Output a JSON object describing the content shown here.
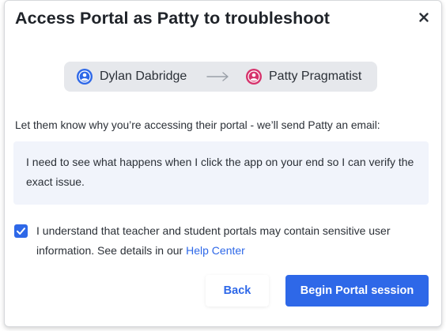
{
  "dialog": {
    "title": "Access Portal as Patty to troubleshoot",
    "close_icon": "close-icon"
  },
  "impersonation": {
    "from_user": {
      "name": "Dylan Dabridge",
      "icon": "user-circle-icon",
      "color": "#2e68e8"
    },
    "arrow_icon": "arrow-right-icon",
    "to_user": {
      "name": "Patty Pragmatist",
      "icon": "user-circle-icon",
      "color": "#d6336c"
    }
  },
  "reason": {
    "prompt": "Let them know why you’re accessing their portal - we’ll send Patty an email:",
    "message": "I need to see what happens when I click the app on your end so I can verify the exact issue."
  },
  "consent": {
    "checked": true,
    "text": "I understand that teacher and student portals may contain sensitive user information. See details in our ",
    "link_text": "Help Center"
  },
  "actions": {
    "back_label": "Back",
    "begin_label": "Begin Portal session"
  },
  "colors": {
    "accent": "#2e68e8",
    "pill_bg": "#e6e8ec",
    "message_bg": "#f1f4fb"
  }
}
